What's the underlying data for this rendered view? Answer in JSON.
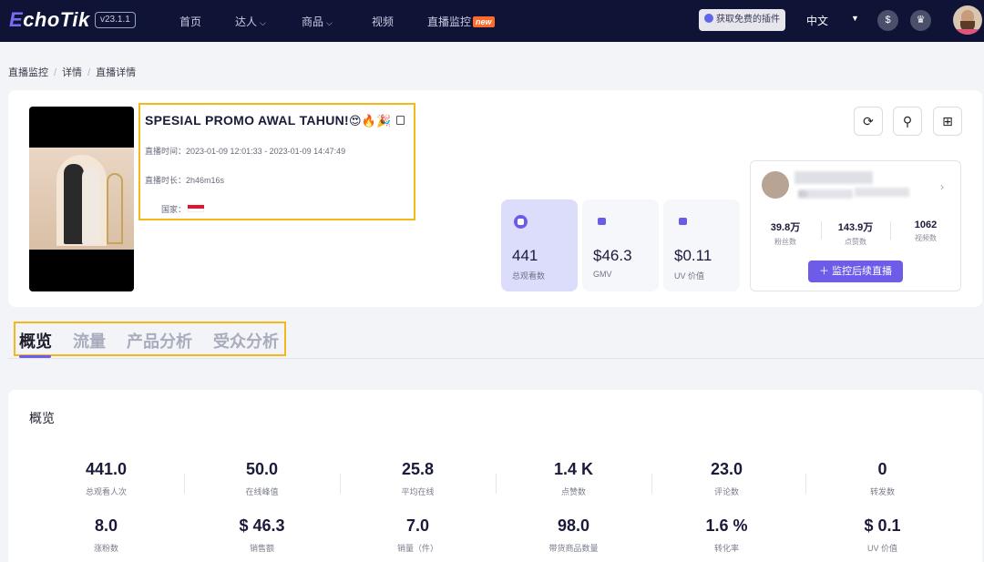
{
  "nav": {
    "logo_prefix": "E",
    "logo_rest": "choTik",
    "version": "v23.1.1",
    "items": [
      {
        "label": "首页"
      },
      {
        "label": "达人"
      },
      {
        "label": "商品"
      },
      {
        "label": "视频"
      },
      {
        "label": "直播监控"
      }
    ],
    "new_badge": "new",
    "plugin_button": "获取免费的插件",
    "language": "中文"
  },
  "breadcrumb": [
    "直播监控",
    "详情",
    "直播详情"
  ],
  "live": {
    "title": "SPESIAL PROMO AWAL TAHUN!",
    "title_emoji": "😍🔥🎉",
    "time_label": "直播时间：",
    "time_value": "2023-01-09 12:01:33 - 2023-01-09 14:47:49",
    "duration_label": "直播时长：",
    "duration_value": "2h46m16s",
    "country_label": "国家："
  },
  "stats": [
    {
      "value": "441",
      "label": "总观看数"
    },
    {
      "value": "$46.3",
      "label": "GMV"
    },
    {
      "value": "$0.11",
      "label": "UV 价值"
    }
  ],
  "host": {
    "id_label": "ID:",
    "stats": [
      {
        "value": "39.8万",
        "label": "粉丝数"
      },
      {
        "value": "143.9万",
        "label": "点赞数"
      },
      {
        "value": "1062",
        "label": "视频数"
      }
    ],
    "follow_button": "监控后续直播"
  },
  "tabs": [
    "概览",
    "流量",
    "产品分析",
    "受众分析"
  ],
  "overview": {
    "title": "概览",
    "row1": [
      {
        "value": "441.0",
        "label": "总观看人次"
      },
      {
        "value": "50.0",
        "label": "在线峰值"
      },
      {
        "value": "25.8",
        "label": "平均在线"
      },
      {
        "value": "1.4 K",
        "label": "点赞数"
      },
      {
        "value": "23.0",
        "label": "评论数"
      },
      {
        "value": "0",
        "label": "转发数"
      }
    ],
    "row2": [
      {
        "value": "8.0",
        "label": "涨粉数"
      },
      {
        "value": "$ 46.3",
        "label": "销售额"
      },
      {
        "value": "7.0",
        "label": "销量（件）"
      },
      {
        "value": "98.0",
        "label": "带货商品数量"
      },
      {
        "value": "1.6 %",
        "label": "转化率"
      },
      {
        "value": "$ 0.1",
        "label": "UV 价值"
      }
    ]
  },
  "colors": {
    "nav_bg": "#0f1437",
    "accent": "#6c5ce7",
    "highlight_border": "#f6b71a"
  }
}
